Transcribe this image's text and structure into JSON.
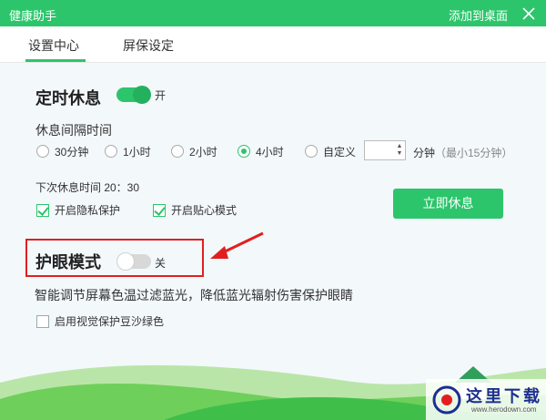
{
  "titlebar": {
    "app_title": "健康助手",
    "add_to_desktop": "添加到桌面"
  },
  "tabs": [
    {
      "label": "设置中心",
      "active": true
    },
    {
      "label": "屏保设定",
      "active": false
    }
  ],
  "timed_rest": {
    "title": "定时休息",
    "toggle_state": "开",
    "toggle_on": true,
    "interval_label": "休息间隔时间",
    "options": [
      {
        "label": "30分钟",
        "selected": false
      },
      {
        "label": "1小时",
        "selected": false
      },
      {
        "label": "2小时",
        "selected": false
      },
      {
        "label": "4小时",
        "selected": true
      },
      {
        "label": "自定义",
        "selected": false
      }
    ],
    "custom_value": "",
    "custom_unit": "分钟",
    "custom_hint": "（最小15分钟）",
    "next_rest": "下次休息时间 20：30",
    "privacy_label": "开启隐私保护",
    "privacy_checked": true,
    "caring_label": "开启贴心模式",
    "caring_checked": true,
    "rest_now_button": "立即休息"
  },
  "eye_mode": {
    "title": "护眼模式",
    "toggle_state": "关",
    "toggle_on": false,
    "description": "智能调节屏幕色温过滤蓝光，降低蓝光辐射伤害保护眼睛",
    "bean_green_label": "启用视觉保护豆沙绿色",
    "bean_green_checked": false
  },
  "watermark": {
    "text": "这里下载",
    "url": "www.herodown.com"
  },
  "colors": {
    "accent": "#2cc56b",
    "highlight": "#e21f1f"
  }
}
